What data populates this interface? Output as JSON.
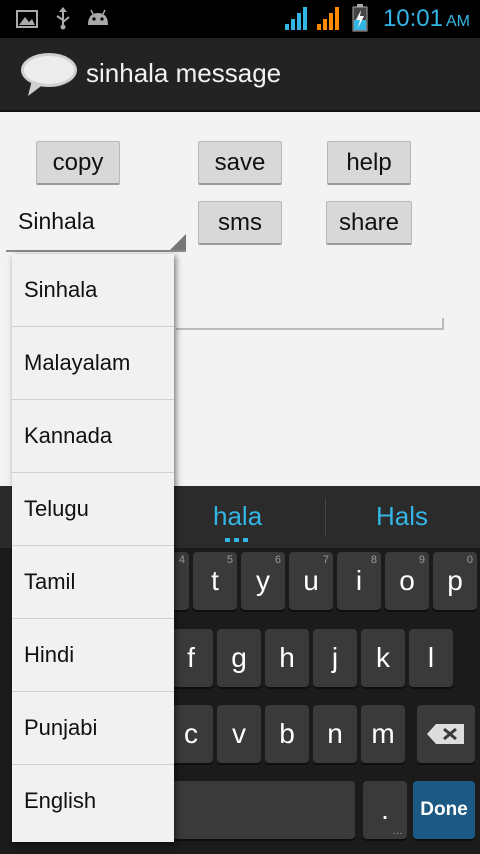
{
  "status_bar": {
    "time": "10:01",
    "ampm": "AM",
    "icons": [
      "image-icon",
      "usb-icon",
      "android-icon",
      "signal-icon-1",
      "signal-icon-2",
      "battery-charging-icon"
    ]
  },
  "app": {
    "title": "sinhala message"
  },
  "buttons": {
    "copy": "copy",
    "save": "save",
    "help": "help",
    "sms": "sms",
    "share": "share"
  },
  "spinner": {
    "selected": "Sinhala"
  },
  "dropdown": {
    "items": [
      "Sinhala",
      "Malayalam",
      "Kannada",
      "Telugu",
      "Tamil",
      "Hindi",
      "Punjabi",
      "English"
    ]
  },
  "keyboard": {
    "suggestions": [
      "hala",
      "Hals"
    ],
    "row1": [
      {
        "label": "t",
        "sub": "5"
      },
      {
        "label": "y",
        "sub": "6"
      },
      {
        "label": "u",
        "sub": "7"
      },
      {
        "label": "i",
        "sub": "8"
      },
      {
        "label": "o",
        "sub": "9"
      },
      {
        "label": "p",
        "sub": "0"
      }
    ],
    "row1_hidden_sub": "4",
    "row2": [
      "f",
      "g",
      "h",
      "j",
      "k",
      "l"
    ],
    "row3": [
      "c",
      "v",
      "b",
      "n",
      "m"
    ],
    "period": ".",
    "period_sub": "…",
    "done": "Done"
  },
  "colors": {
    "accent": "#33b5e5",
    "content_bg": "#f3f3f3",
    "actionbar_bg": "#232323"
  }
}
